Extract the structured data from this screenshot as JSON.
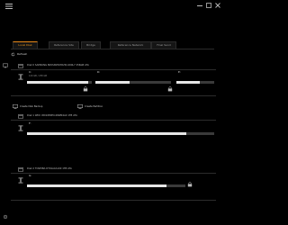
{
  "tabs": [
    {
      "label": "Local Disk",
      "active": true
    },
    {
      "label": "Reference Site",
      "active": false
    },
    {
      "label": "Bridge",
      "active": false
    },
    {
      "label": "Reference Network",
      "active": false
    },
    {
      "label": "Final Send",
      "active": false
    }
  ],
  "toolbar": {
    "refresh_label": "Refresh"
  },
  "drives": [
    {
      "title": "Disk 0 SAMSUNG MZVLB256HAHQ-000L7 256GB ATA",
      "partitions": [
        {
          "name": "C:",
          "info": "120 GB / 238 GB",
          "fill_fraction": 0.95
        },
        {
          "name": "D:",
          "info": "",
          "fill_fraction": 0.45
        },
        {
          "name": "E:",
          "info": "",
          "fill_fraction": 0.62
        }
      ],
      "actions": [
        {
          "label": "Create Disk Backup",
          "icon": "disk-backup-icon"
        },
        {
          "label": "Create Partition",
          "icon": "partition-icon"
        }
      ]
    },
    {
      "title": "Disk 1 WDC WD10EZEX-08WN4A0 1TB ATA",
      "partitions": [
        {
          "name": "F:",
          "info": "",
          "fill_fraction": 0.85
        }
      ]
    },
    {
      "title": "Disk 2 TOSHIBA DT01ACA100 1TB ATA",
      "partitions": [
        {
          "name": "G:",
          "info": "",
          "fill_fraction": 0.88
        }
      ]
    }
  ],
  "colors": {
    "accent": "#e8891a",
    "background": "#000000",
    "bar_fill": "#e6e6e6",
    "bar_track": "#3a3a3a"
  }
}
